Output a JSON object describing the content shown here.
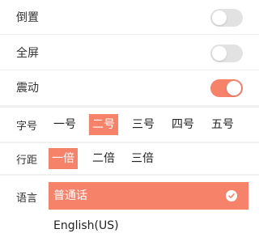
{
  "colors": {
    "accent": "#f7826a",
    "switch_off": "#e2e2e2"
  },
  "toggles": [
    {
      "label": "倒置",
      "on": false
    },
    {
      "label": "全屏",
      "on": false
    },
    {
      "label": "震动",
      "on": true
    }
  ],
  "font_size": {
    "label": "字号",
    "options": [
      "一号",
      "二号",
      "三号",
      "四号",
      "五号"
    ],
    "selected": "二号"
  },
  "line_spacing": {
    "label": "行距",
    "options": [
      "一倍",
      "二倍",
      "三倍"
    ],
    "selected": "一倍"
  },
  "language": {
    "label": "语言",
    "options": [
      "普通话",
      "English(US)"
    ],
    "selected": "普通话"
  }
}
